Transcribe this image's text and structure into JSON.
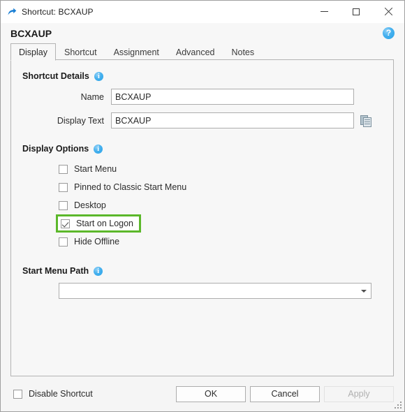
{
  "window": {
    "title": "Shortcut: BCXAUP",
    "icon": "shortcut-arrow-icon",
    "minimize_label": "Minimize",
    "maximize_label": "Maximize",
    "close_label": "Close"
  },
  "header": {
    "title": "BCXAUP",
    "help_glyph": "?"
  },
  "tabs": [
    {
      "label": "Display",
      "active": true
    },
    {
      "label": "Shortcut",
      "active": false
    },
    {
      "label": "Assignment",
      "active": false
    },
    {
      "label": "Advanced",
      "active": false
    },
    {
      "label": "Notes",
      "active": false
    }
  ],
  "shortcut_details": {
    "section_label": "Shortcut Details",
    "info_glyph": "i",
    "fields": [
      {
        "label": "Name",
        "value": "BCXAUP",
        "placeholder": ""
      },
      {
        "label": "Display Text",
        "value": "BCXAUP",
        "placeholder": ""
      }
    ]
  },
  "display_options": {
    "section_label": "Display Options",
    "info_glyph": "i",
    "items": [
      {
        "label": "Start Menu",
        "checked": false,
        "highlighted": false
      },
      {
        "label": "Pinned to Classic Start Menu",
        "checked": false,
        "highlighted": false
      },
      {
        "label": "Desktop",
        "checked": false,
        "highlighted": false
      },
      {
        "label": "Start on Logon",
        "checked": true,
        "highlighted": true
      },
      {
        "label": "Hide Offline",
        "checked": false,
        "highlighted": false
      }
    ]
  },
  "start_menu_path": {
    "section_label": "Start Menu Path",
    "info_glyph": "i",
    "value": "",
    "placeholder": ""
  },
  "footer": {
    "disable_shortcut": {
      "label": "Disable Shortcut",
      "checked": false
    },
    "buttons": [
      {
        "label": "OK",
        "disabled": false
      },
      {
        "label": "Cancel",
        "disabled": false
      },
      {
        "label": "Apply",
        "disabled": true
      }
    ]
  },
  "colors": {
    "highlight_green": "#5cb82b",
    "accent_blue": "#2aa3e8",
    "window_bg": "#f5f5f5",
    "panel_bg": "#f7f7f7"
  }
}
